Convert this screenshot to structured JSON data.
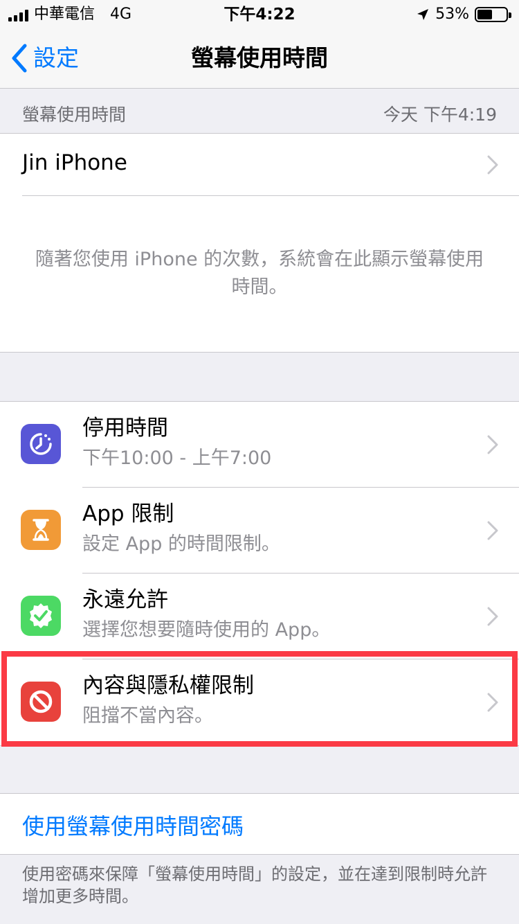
{
  "status_bar": {
    "carrier": "中華電信",
    "network": "4G",
    "time": "下午4:22",
    "battery_percent": "53%",
    "battery_level": 0.53,
    "location_icon": "location-arrow-icon"
  },
  "nav": {
    "back_label": "設定",
    "title": "螢幕使用時間"
  },
  "summary_header": {
    "label": "螢幕使用時間",
    "timestamp": "今天 下午4:19"
  },
  "device": {
    "name": "Jin iPhone",
    "info": "隨著您使用 iPhone 的次數，系統會在此顯示螢幕使用時間。"
  },
  "features": [
    {
      "title": "停用時間",
      "subtitle": "下午10:00 - 上午7:00",
      "icon": "downtime-icon",
      "color": "#5856d6"
    },
    {
      "title": "App 限制",
      "subtitle": "設定 App 的時間限制。",
      "icon": "hourglass-icon",
      "color": "#f19a37"
    },
    {
      "title": "永遠允許",
      "subtitle": "選擇您想要隨時使用的 App。",
      "icon": "checkmark-seal-icon",
      "color": "#4cd964"
    },
    {
      "title": "內容與隱私權限制",
      "subtitle": "阻擋不當內容。",
      "icon": "restriction-icon",
      "color": "#e8423c"
    }
  ],
  "passcode": {
    "label": "使用螢幕使用時間密碼",
    "footer": "使用密碼來保障「螢幕使用時間」的設定，並在達到限制時允許增加更多時間。"
  },
  "colors": {
    "accent": "#007aff",
    "highlight": "#fb3a45"
  }
}
